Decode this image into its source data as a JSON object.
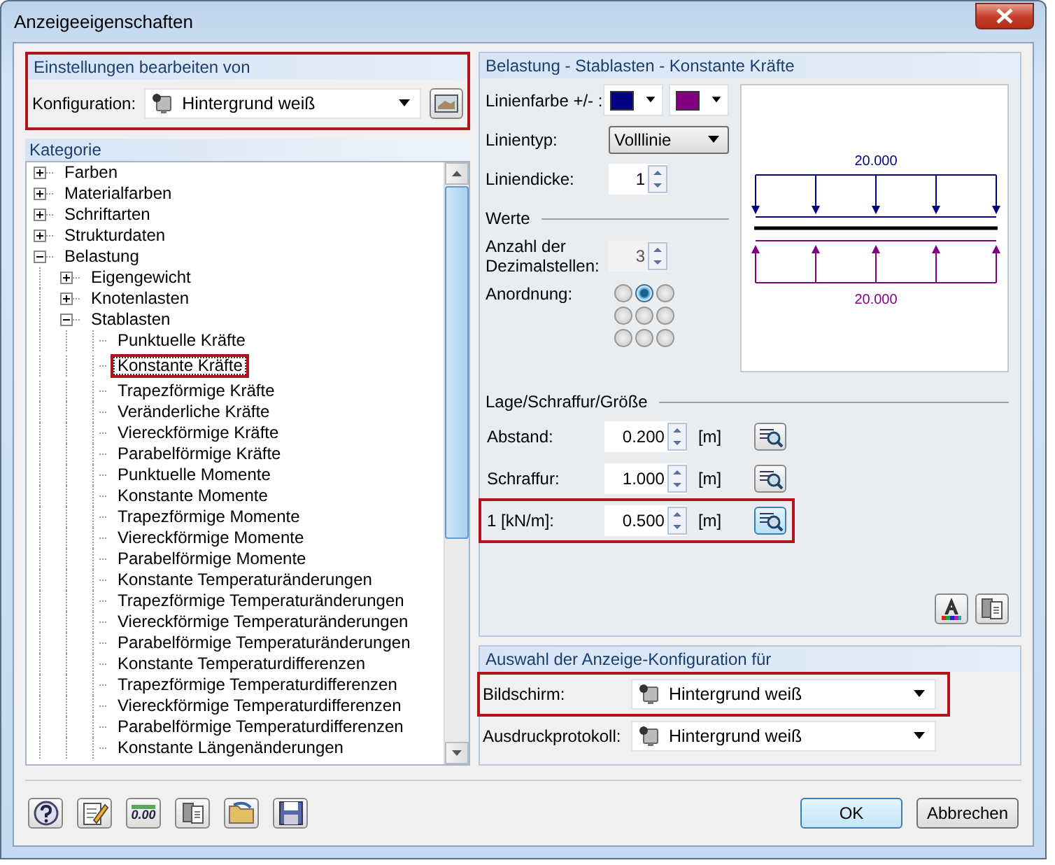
{
  "window": {
    "title": "Anzeigeeigenschaften"
  },
  "settings": {
    "title": "Einstellungen bearbeiten von",
    "highlighted": true,
    "label": "Konfiguration:",
    "value": "Hintergrund weiß"
  },
  "category": {
    "title": "Kategorie",
    "tree": [
      {
        "label": "Farben",
        "expanded": false,
        "selected": false,
        "highlighted": false
      },
      {
        "label": "Materialfarben",
        "expanded": false,
        "selected": false,
        "highlighted": false
      },
      {
        "label": "Schriftarten",
        "expanded": false,
        "selected": false,
        "highlighted": false
      },
      {
        "label": "Strukturdaten",
        "expanded": false,
        "selected": false,
        "highlighted": false
      },
      {
        "label": "Belastung",
        "expanded": true,
        "selected": false,
        "highlighted": false,
        "children": [
          {
            "label": "Eigengewicht",
            "expanded": false,
            "selected": false,
            "highlighted": false
          },
          {
            "label": "Knotenlasten",
            "expanded": false,
            "selected": false,
            "highlighted": false
          },
          {
            "label": "Stablasten",
            "expanded": true,
            "selected": false,
            "highlighted": false,
            "children": [
              {
                "label": "Punktuelle Kräfte",
                "selected": false,
                "highlighted": false
              },
              {
                "label": "Konstante Kräfte",
                "selected": true,
                "highlighted": true
              },
              {
                "label": "Trapezförmige Kräfte",
                "selected": false,
                "highlighted": false
              },
              {
                "label": "Veränderliche Kräfte",
                "selected": false,
                "highlighted": false
              },
              {
                "label": "Viereckförmige Kräfte",
                "selected": false,
                "highlighted": false
              },
              {
                "label": "Parabelförmige Kräfte",
                "selected": false,
                "highlighted": false
              },
              {
                "label": "Punktuelle Momente",
                "selected": false,
                "highlighted": false
              },
              {
                "label": "Konstante Momente",
                "selected": false,
                "highlighted": false
              },
              {
                "label": "Trapezförmige Momente",
                "selected": false,
                "highlighted": false
              },
              {
                "label": "Viereckförmige Momente",
                "selected": false,
                "highlighted": false
              },
              {
                "label": "Parabelförmige Momente",
                "selected": false,
                "highlighted": false
              },
              {
                "label": "Konstante Temperaturänderungen",
                "selected": false,
                "highlighted": false
              },
              {
                "label": "Trapezförmige Temperaturänderungen",
                "selected": false,
                "highlighted": false
              },
              {
                "label": "Viereckförmige Temperaturänderungen",
                "selected": false,
                "highlighted": false
              },
              {
                "label": "Parabelförmige Temperaturänderungen",
                "selected": false,
                "highlighted": false
              },
              {
                "label": "Konstante Temperaturdifferenzen",
                "selected": false,
                "highlighted": false
              },
              {
                "label": "Trapezförmige Temperaturdifferenzen",
                "selected": false,
                "highlighted": false
              },
              {
                "label": "Viereckförmige Temperaturdifferenzen",
                "selected": false,
                "highlighted": false
              },
              {
                "label": "Parabelförmige Temperaturdifferenzen",
                "selected": false,
                "highlighted": false
              },
              {
                "label": "Konstante Längenänderungen",
                "selected": false,
                "highlighted": false
              }
            ]
          }
        ]
      }
    ]
  },
  "details": {
    "title": "Belastung - Stablasten - Konstante Kräfte",
    "line_color": {
      "label": "Linienfarbe +/- :",
      "colors": [
        {
          "color": "#000080"
        },
        {
          "color": "#800080"
        }
      ]
    },
    "line_type": {
      "label": "Linientyp:",
      "value": "Volllinie"
    },
    "line_width": {
      "label": "Liniendicke:",
      "value": "1"
    },
    "values_title": "Werte",
    "decimals": {
      "label": "Anzahl der Dezimalstellen:",
      "value": "3",
      "disabled": true
    },
    "arrangement": {
      "label": "Anordnung:",
      "options": [
        {
          "selected": false
        },
        {
          "selected": true
        },
        {
          "selected": false
        },
        {
          "selected": false
        },
        {
          "selected": false
        },
        {
          "selected": false
        },
        {
          "selected": false
        },
        {
          "selected": false
        },
        {
          "selected": false
        }
      ]
    },
    "preview": {
      "top_label": "20.000",
      "bottom_label": "20.000"
    },
    "position_title": "Lage/Schraffur/Größe",
    "position_rows": [
      {
        "label": "Abstand:",
        "value": "0.200",
        "unit": "[m]",
        "highlighted": false,
        "focused": false
      },
      {
        "label": "Schraffur:",
        "value": "1.000",
        "unit": "[m]",
        "highlighted": false,
        "focused": false
      },
      {
        "label": "1  [kN/m]:",
        "value": "0.500",
        "unit": "[m]",
        "highlighted": true,
        "focused": true
      }
    ],
    "tools": [
      {
        "kind": "font-color"
      },
      {
        "kind": "copy"
      }
    ]
  },
  "display_config": {
    "title": "Auswahl der Anzeige-Konfiguration für",
    "rows": [
      {
        "label": "Bildschirm:",
        "value": "Hintergrund weiß",
        "highlighted": true
      },
      {
        "label": "Ausdruckprotokoll:",
        "value": "Hintergrund weiß",
        "highlighted": false
      }
    ]
  },
  "toolbar": [
    {
      "kind": "help"
    },
    {
      "kind": "edit"
    },
    {
      "kind": "decimals",
      "label": "0.00"
    },
    {
      "kind": "copy"
    },
    {
      "kind": "open"
    },
    {
      "kind": "save"
    }
  ],
  "buttons": [
    {
      "label": "OK",
      "default": true
    },
    {
      "label": "Abbrechen",
      "default": false
    }
  ]
}
